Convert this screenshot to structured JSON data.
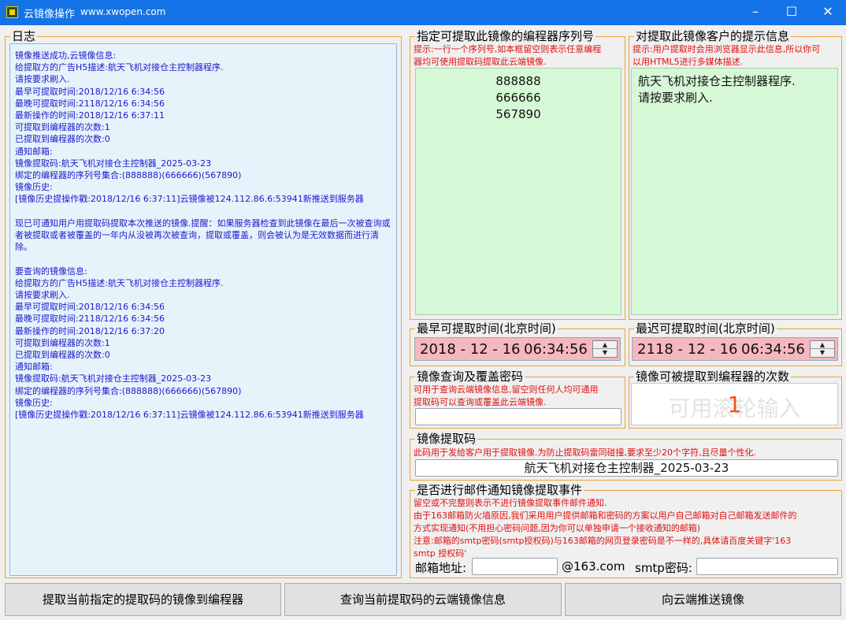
{
  "window": {
    "title": "云镜像操作",
    "site": "www.xwopen.com",
    "min_glyph": "–",
    "max_glyph": "☐",
    "close_glyph": "✕"
  },
  "log": {
    "title": "日志",
    "text": "镜像推送成功,云镜像信息:\n给提取方的广告H5描述:航天飞机对接仓主控制器程序.\n请按要求刷入.\n最早可提取时间:2018/12/16 6:34:56\n最晚可提取时间:2118/12/16 6:34:56\n最新操作的时间:2018/12/16 6:37:11\n可提取到编程器的次数:1\n已提取到编程器的次数:0\n通知邮箱:\n镜像提取码:航天飞机对接仓主控制器_2025-03-23\n绑定的编程器的序列号集合:(888888)(666666)(567890)\n镜像历史:\n[镜像历史提操作戳:2018/12/16 6:37:11]云镜像被124.112.86.6:53941新推送到服务器\n\n现已可通知用户用提取码提取本次推送的镜像.提醒：如果服务器检查到此镜像在最后一次被查询或者被提取或者被覆盖的一年内从没被再次被查询，提取或覆盖，则会被认为是无效数据而进行清除。\n\n要查询的镜像信息:\n给提取方的广告H5描述:航天飞机对接仓主控制器程序.\n请按要求刷入.\n最早可提取时间:2018/12/16 6:34:56\n最晚可提取时间:2118/12/16 6:34:56\n最新操作的时间:2018/12/16 6:37:20\n可提取到编程器的次数:1\n已提取到编程器的次数:0\n通知邮箱:\n镜像提取码:航天飞机对接仓主控制器_2025-03-23\n绑定的编程器的序列号集合:(888888)(666666)(567890)\n镜像历史:\n[镜像历史提操作戳:2018/12/16 6:37:11]云镜像被124.112.86.6:53941新推送到服务器"
  },
  "serials": {
    "title": "指定可提取此镜像的编程器序列号",
    "hint_line1": "提示:一行一个序列号,如本框留空则表示任意编程",
    "hint_line2": "器均可使用提取码提取此云端镜像.",
    "values": [
      "888888",
      "666666",
      "567890"
    ]
  },
  "message": {
    "title": "对提取此镜像客户的提示信息",
    "hint_line1": "提示:用户提取时会用浏览器显示此信息,所以你可",
    "hint_line2": "以用HTML5进行多媒体描述.",
    "text": "航天飞机对接仓主控制器程序.\n请按要求刷入."
  },
  "earliest": {
    "title": "最早可提取时间(北京时间)",
    "date": "2018 - 12 - 16",
    "time": "06:34:56"
  },
  "latest": {
    "title": "最迟可提取时间(北京时间)",
    "date": "2118 - 12 - 16",
    "time": "06:34:56"
  },
  "password": {
    "title": "镜像查询及覆盖密码",
    "hint_line1": "可用于查询云端镜像信息,留空则任何人均可通用",
    "hint_line2": "提取码可以查询或覆盖此云端镜像.",
    "value": ""
  },
  "count": {
    "title": "镜像可被提取到编程器的次数",
    "placeholder": "可用滚轮输入",
    "value": "1"
  },
  "code": {
    "title": "镜像提取码",
    "hint": "此码用于发给客户用于提取镜像.为防止提取码雷同碰撞,要求至少20个字符,且尽量个性化.",
    "value": "航天飞机对接仓主控制器_2025-03-23"
  },
  "mail": {
    "title": "是否进行邮件通知镜像提取事件",
    "hint_line1": "留空或不完整则表示不进行镜像提取事件邮件通知.",
    "hint_line2": "由于163邮箱防火墙原因,我们采用用户提供邮箱和密码的方案以用户自己邮箱对自己邮箱发送邮件的",
    "hint_line3": "方式实现通知(不用担心密码问题,因为你可以单独申请一个接收通知的邮箱)",
    "hint_line4": "注意:邮箱的smtp密码(smtp授权码)与163邮箱的网页登录密码是不一样的,具体请百度关键字'163",
    "hint_line5": "smtp 授权码'",
    "address_label": "邮箱地址:",
    "domain": "@163.com",
    "smtp_label": "smtp密码:",
    "address_value": "",
    "smtp_value": ""
  },
  "buttons": {
    "extract": "提取当前指定的提取码的镜像到编程器",
    "query": "查询当前提取码的云端镜像信息",
    "push": "向云端推送镜像"
  }
}
